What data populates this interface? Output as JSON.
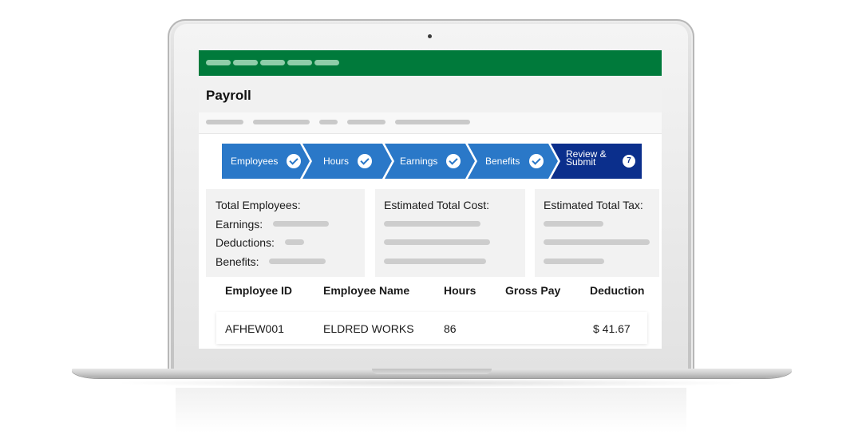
{
  "app": {
    "title": "Payroll"
  },
  "stepper": {
    "steps": [
      {
        "label": "Employees",
        "status": "complete",
        "icon": "check-icon"
      },
      {
        "label": "Hours",
        "status": "complete",
        "icon": "check-icon"
      },
      {
        "label": "Earnings",
        "status": "complete",
        "icon": "check-icon"
      },
      {
        "label": "Benefits",
        "status": "complete",
        "icon": "check-icon"
      },
      {
        "label": "Review & Submit",
        "status": "active",
        "badge": "7"
      }
    ]
  },
  "summary": {
    "card1": {
      "total_employees_label": "Total Employees:",
      "earnings_label": "Earnings:",
      "deductions_label": "Deductions:",
      "benefits_label": "Benefits:"
    },
    "card2": {
      "label": "Estimated Total Cost:"
    },
    "card3": {
      "label": "Estimated Total Tax:"
    }
  },
  "table": {
    "columns": [
      "Employee ID",
      "Employee Name",
      "Hours",
      "Gross Pay",
      "Deduction"
    ],
    "rows": [
      {
        "employee_id": "AFHEW001",
        "employee_name": "ELDRED WORKS",
        "hours": "86",
        "gross_pay": "",
        "deduction": "$ 41.67"
      }
    ]
  },
  "colors": {
    "brand_green": "#007a3b",
    "step_blue": "#2a78c8",
    "step_active": "#0b2f8c",
    "placeholder_gray": "#cdcdcd"
  }
}
